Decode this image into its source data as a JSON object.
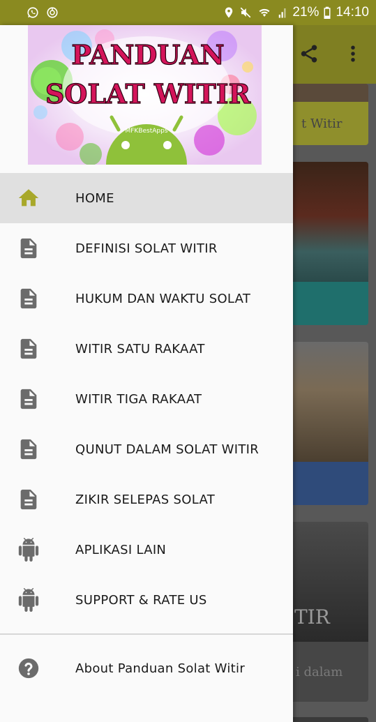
{
  "status_bar": {
    "battery_percent": "21%",
    "time": "14:10"
  },
  "header": {
    "title_line1": "PANDUAN",
    "title_line2": "SOLAT WITIR",
    "brand": "MFKBestApps"
  },
  "menu": {
    "items": [
      {
        "label": "HOME",
        "icon": "home-icon"
      },
      {
        "label": "DEFINISI SOLAT WITIR",
        "icon": "document-icon"
      },
      {
        "label": "HUKUM DAN WAKTU SOLAT",
        "icon": "document-icon"
      },
      {
        "label": "WITIR SATU RAKAAT",
        "icon": "document-icon"
      },
      {
        "label": "WITIR TIGA RAKAAT",
        "icon": "document-icon"
      },
      {
        "label": "QUNUT DALAM SOLAT WITIR",
        "icon": "document-icon"
      },
      {
        "label": "ZIKIR SELEPAS SOLAT",
        "icon": "document-icon"
      },
      {
        "label": "APLIKASI LAIN",
        "icon": "android-icon"
      },
      {
        "label": "SUPPORT & RATE US",
        "icon": "android-icon"
      }
    ],
    "about_label": "About Panduan Solat Witir"
  },
  "background": {
    "card1_caption": "t Witir",
    "card4_overlay": "TIR",
    "card4_caption": "i dalam"
  },
  "colors": {
    "status_bar": "#8a8a20",
    "toolbar": "#7f7f22",
    "active_icon": "#a8a82a",
    "icon_gray": "#6b6b6b",
    "drawer_bg": "#fafafa",
    "active_row": "#e0e0e0"
  }
}
